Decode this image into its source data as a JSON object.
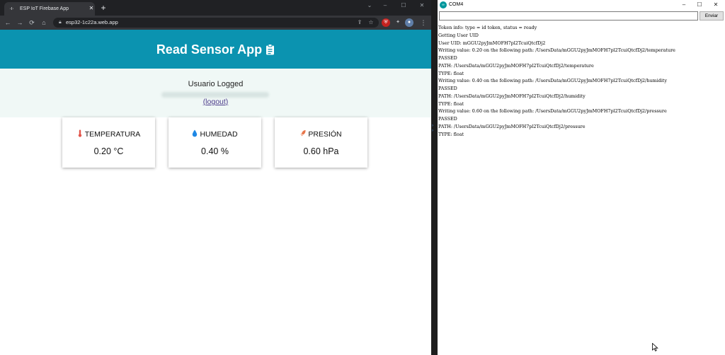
{
  "browser": {
    "tab_title": "ESP IoT Firebase App",
    "tab_close": "✕",
    "new_tab": "+",
    "url": "esp32-1c22a.web.app",
    "window_controls": {
      "minimize": "–",
      "maximize": "☐",
      "close": "✕"
    }
  },
  "app": {
    "title": "Read Sensor App",
    "user_label": "Usuario Logged",
    "logout": "(logout)",
    "cards": [
      {
        "title": "TEMPERATURA",
        "value": "0.20 °C",
        "icon": "thermometer-icon",
        "color": "#e2554b"
      },
      {
        "title": "HUMEDAD",
        "value": "0.40 %",
        "icon": "water-drop-icon",
        "color": "#1e88e5"
      },
      {
        "title": "PRESIÓN",
        "value": "0.60 hPa",
        "icon": "rocket-icon",
        "color": "#e8764b"
      }
    ],
    "header_color": "#0b93b0",
    "login_area_color": "#f0f8f6"
  },
  "serial": {
    "title": "COM4",
    "send": "Enviar",
    "window_controls": {
      "minimize": "–",
      "maximize": "☐",
      "close": "✕"
    },
    "lines": [
      "Token info: type = id token, status = ready",
      "Getting User UID",
      "User UID: mGGU2pyJmMOFH7pl2TcuiQtcfDj2",
      "Writing value: 0.20 on the following path: /UsersData/mGGU2pyJmMOFH7pl2TcuiQtcfDj2/temperature",
      "PASSED",
      "PATH: /UsersData/mGGU2pyJmMOFH7pl2TcuiQtcfDj2/temperature",
      "TYPE: float",
      "Writing value: 0.40 on the following path: /UsersData/mGGU2pyJmMOFH7pl2TcuiQtcfDj2/humidity",
      "PASSED",
      "PATH: /UsersData/mGGU2pyJmMOFH7pl2TcuiQtcfDj2/humidity",
      "TYPE: float",
      "Writing value: 0.60 on the following path: /UsersData/mGGU2pyJmMOFH7pl2TcuiQtcfDj2/pressure",
      "PASSED",
      "PATH: /UsersData/mGGU2pyJmMOFH7pl2TcuiQtcfDj2/pressure",
      "TYPE: float"
    ]
  }
}
